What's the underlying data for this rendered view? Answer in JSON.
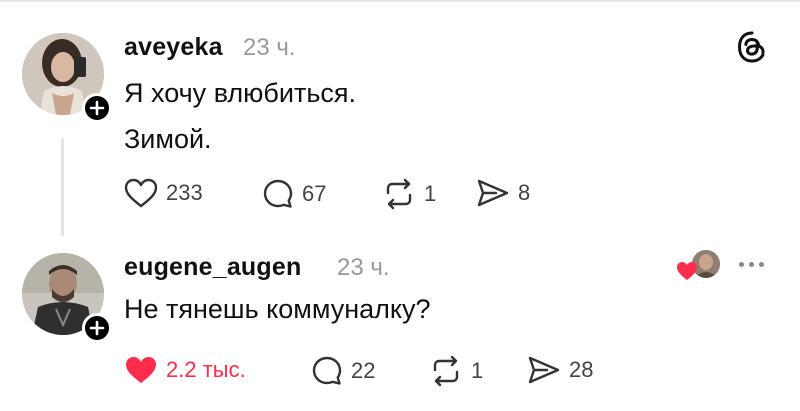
{
  "posts": [
    {
      "username": "aveyeka",
      "time": "23 ч.",
      "lines": [
        "Я хочу влюбиться.",
        "Зимой."
      ],
      "likes": "233",
      "replies": "67",
      "reposts": "1",
      "shares": "8",
      "liked": false
    },
    {
      "username": "eugene_augen",
      "time": "23 ч.",
      "lines": [
        "Не тянешь коммуналку?"
      ],
      "likes": "2.2 тыс.",
      "replies": "22",
      "reposts": "1",
      "shares": "28",
      "liked": true
    }
  ],
  "icons": {
    "app": "threads-logo-icon",
    "more": "more-dots-icon",
    "like": "heart-icon",
    "reply": "comment-icon",
    "repost": "repost-icon",
    "share": "share-send-icon",
    "follow": "plus-icon"
  },
  "colors": {
    "like_active": "#ff2d4b",
    "muted": "#9a9a9a"
  }
}
